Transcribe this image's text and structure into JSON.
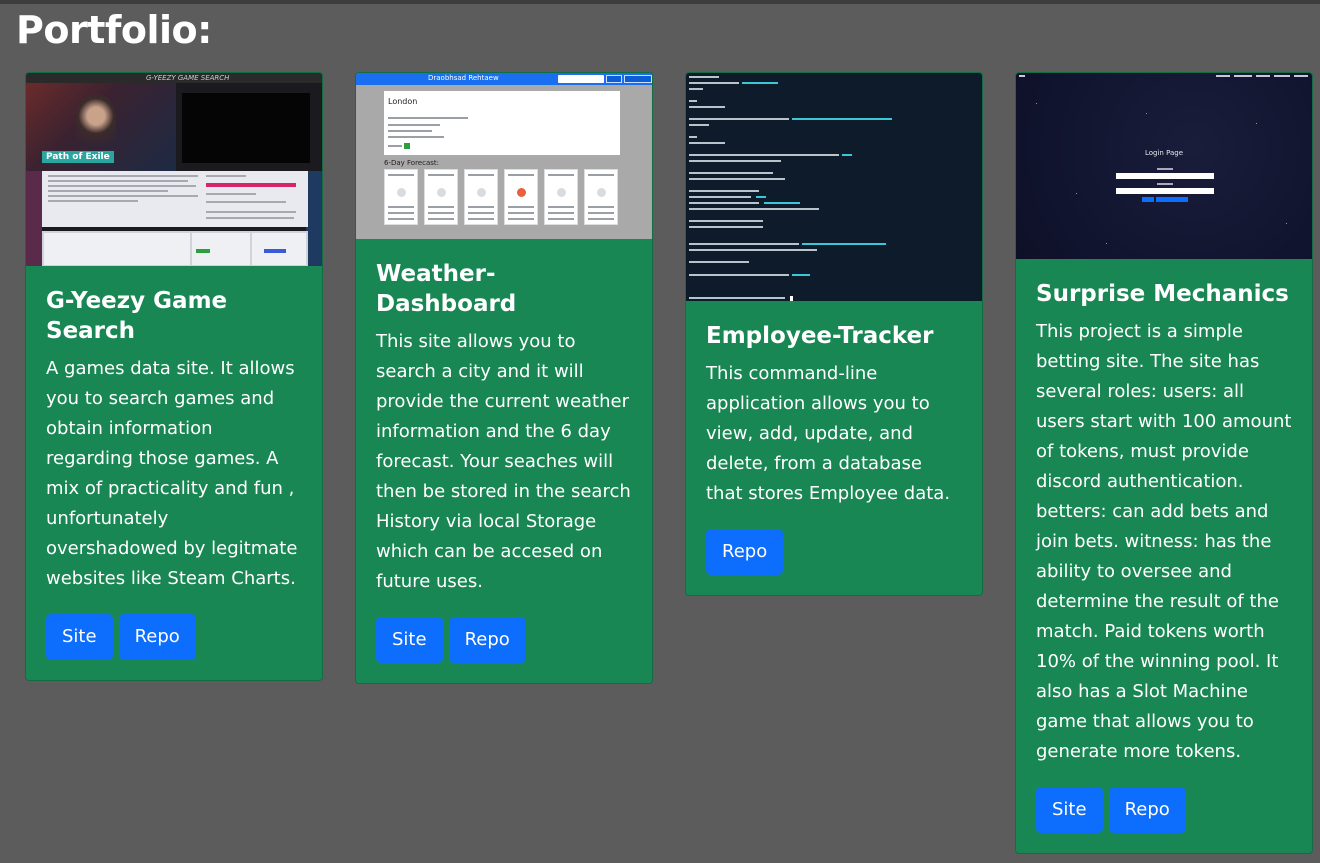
{
  "page": {
    "title": "Portfolio:"
  },
  "projects": [
    {
      "title": "G-Yeezy Game Search",
      "description": "A games data site. It allows you to search games and obtain information regarding those games. A mix of practicality and fun , unfortunately overshadowed by legitmate websites like Steam Charts.",
      "site_label": "Site",
      "repo_label": "Repo",
      "thumbnail": {
        "logo": "G-YEEZY GAME SEARCH",
        "game": "Path of Exile"
      }
    },
    {
      "title": "Weather-Dashboard",
      "description": "This site allows you to search a city and it will provide the current weather information and the 6 day forecast. Your seaches will then be stored in the search History via local Storage which can be accesed on future uses.",
      "site_label": "Site",
      "repo_label": "Repo",
      "thumbnail": {
        "header": "Draobhsad Rehtaew",
        "city": "London",
        "forecast": "6-Day Forecast:"
      }
    },
    {
      "title": "Employee-Tracker",
      "description": "This command-line application allows you to view, add, update, and delete, from a database that stores Employee data.",
      "repo_label": "Repo"
    },
    {
      "title": "Surprise Mechanics",
      "description": "This project is a simple betting site. The site has several roles: users: all users start with 100 amount of tokens, must provide discord authentication. betters: can add bets and join bets. witness: has the ability to oversee and determine the result of the match. Paid tokens worth 10% of the winning pool. It also has a Slot Machine game that allows you to generate more tokens.",
      "site_label": "Site",
      "repo_label": "Repo",
      "thumbnail": {
        "heading": "Login Page"
      }
    }
  ],
  "colors": {
    "background": "#5c5c5c",
    "card": "#198754",
    "button": "#0d6efd"
  }
}
